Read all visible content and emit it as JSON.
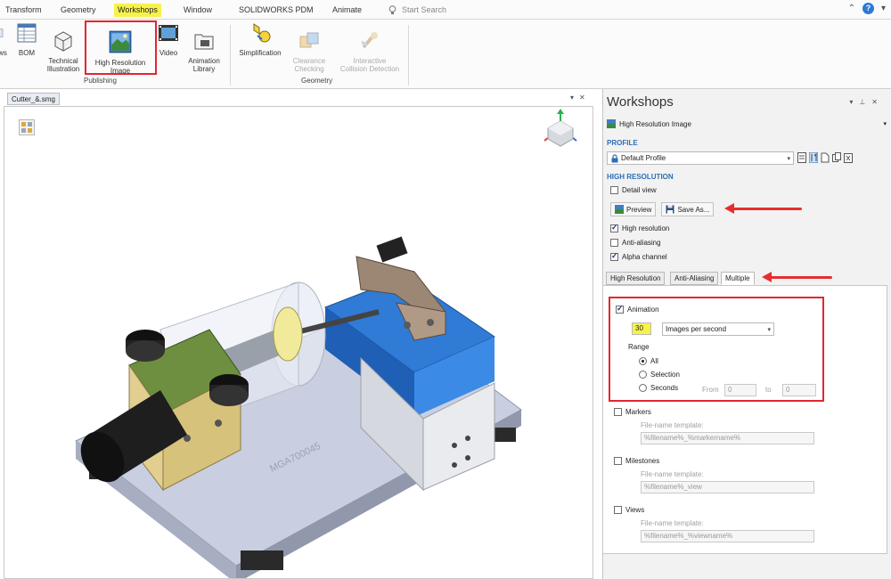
{
  "menu": {
    "tabs": [
      {
        "label": "Transform"
      },
      {
        "label": "Geometry"
      },
      {
        "label": "Workshops",
        "active": true
      },
      {
        "label": "Window"
      },
      {
        "label": "SOLIDWORKS PDM"
      },
      {
        "label": "Animate"
      }
    ],
    "search_placeholder": "Start Search",
    "help": "?"
  },
  "ribbon": {
    "publishing": {
      "views_label": "ws",
      "bom_label": "BOM",
      "technical_label": "Technical\nIllustration",
      "hires_label": "High Resolution\nImage",
      "video_label": "Video",
      "anim_library_label": "Animation\nLibrary",
      "group_label": "Publishing"
    },
    "geometry": {
      "simplification_label": "Simplification",
      "clearance_label": "Clearance\nChecking",
      "collision_label": "Interactive\nCollision Detection",
      "group_label": "Geometry"
    }
  },
  "document": {
    "tab_label": "Cutter_&.smg",
    "engraving": "MGA700045"
  },
  "panel": {
    "title": "Workshops",
    "workshop_select": "High Resolution Image",
    "profile_header": "PROFILE",
    "profile_value": "Default Profile",
    "hires_header": "HIGH RESOLUTION",
    "detail_view_label": "Detail view",
    "detail_view_checked": false,
    "preview_label": "Preview",
    "save_as_label": "Save As...",
    "high_resolution_label": "High resolution",
    "high_resolution_checked": true,
    "anti_aliasing_label": "Anti-aliasing",
    "anti_aliasing_checked": false,
    "alpha_channel_label": "Alpha channel",
    "alpha_channel_checked": true,
    "sub_tabs": [
      {
        "label": "High Resolution"
      },
      {
        "label": "Anti-Aliasing"
      },
      {
        "label": "Multiple",
        "active": true
      }
    ],
    "animation": {
      "label": "Animation",
      "checked": true,
      "rate_value": "30",
      "rate_unit": "Images per second",
      "range_label": "Range",
      "range_all": "All",
      "range_selection": "Selection",
      "range_seconds": "Seconds",
      "from_label": "From",
      "from_value": "0",
      "to_label": "to",
      "to_value": "0"
    },
    "markers": {
      "label": "Markers",
      "template_hint": "File-name template:",
      "template_value": "%filename%_%markername%"
    },
    "milestones": {
      "label": "Milestones",
      "template_hint": "File-name template:",
      "template_value": "%filename%_view"
    },
    "views": {
      "label": "Views",
      "template_hint": "File-name template:",
      "template_value": "%filename%_%viewname%"
    }
  },
  "colors": {
    "highlight_red": "#e0282e",
    "tab_yellow": "#f7f24a",
    "section_blue": "#2d6db4"
  }
}
